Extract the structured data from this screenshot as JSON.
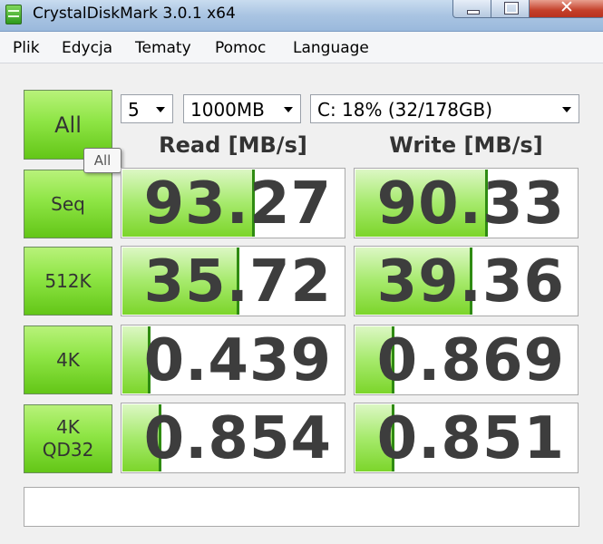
{
  "window": {
    "title": "CrystalDiskMark 3.0.1 x64",
    "close_glyph": "✕"
  },
  "menu": [
    "Plik",
    "Edycja",
    "Tematy",
    "Pomoc",
    "Language"
  ],
  "controls": {
    "count": "5",
    "size": "1000MB",
    "drive": "C: 18% (32/178GB)"
  },
  "buttons": {
    "all": "All",
    "seq": "Seq",
    "k512": "512K",
    "k4": "4K",
    "k4qd32_l1": "4K",
    "k4qd32_l2": "QD32"
  },
  "tooltip": "All",
  "headers": {
    "read": "Read [MB/s]",
    "write": "Write [MB/s]"
  },
  "results": {
    "seq": {
      "read": "93.27",
      "write": "90.33"
    },
    "k512": {
      "read": "35.72",
      "write": "39.36"
    },
    "k4": {
      "read": "0.439",
      "write": "0.869"
    },
    "k4qd32": {
      "read": "0.854",
      "write": "0.851"
    }
  },
  "bar_fill_fraction": {
    "seq": {
      "read": 0.59,
      "write": 0.59
    },
    "k512": {
      "read": 0.52,
      "write": 0.52
    },
    "k4": {
      "read": 0.12,
      "write": 0.17
    },
    "k4qd32": {
      "read": 0.17,
      "write": 0.17
    }
  },
  "status": "",
  "colors": {
    "accent_green": "#7cd52b",
    "value_text": "#3d3d3d",
    "title_bg": "#a9c4e2"
  }
}
